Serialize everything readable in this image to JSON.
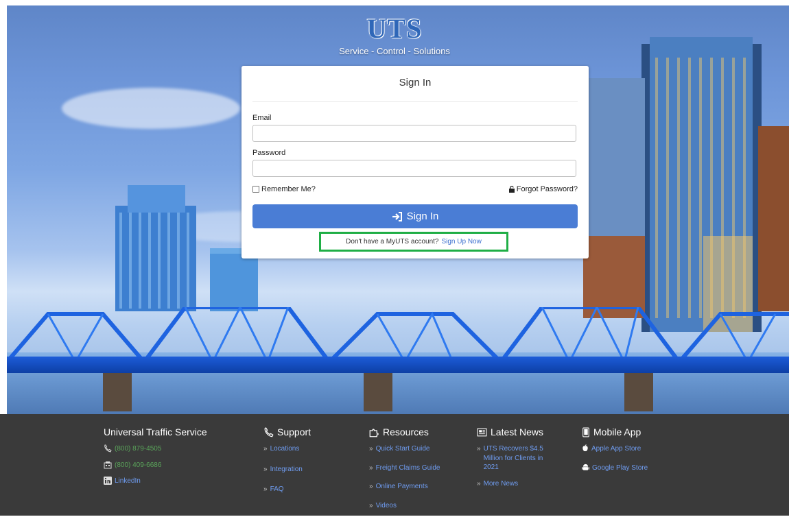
{
  "header": {
    "logo_text": "UTS",
    "tagline": "Service - Control - Solutions"
  },
  "signin_card": {
    "title": "Sign In",
    "email_label": "Email",
    "email_value": "",
    "password_label": "Password",
    "password_value": "",
    "remember_label": "Remember Me?",
    "forgot_label": "Forgot Password?",
    "signin_button_label": "Sign In",
    "signup_prompt": "Don't have a MyUTS account?",
    "signup_link": "Sign Up Now"
  },
  "footer": {
    "company": {
      "title": "Universal Traffic Service",
      "phone1": "(800) 879-4505",
      "phone2": "(800) 409-6686",
      "linkedin": "LinkedIn"
    },
    "support": {
      "title": "Support",
      "items": [
        "Locations",
        "Integration",
        "FAQ"
      ]
    },
    "resources": {
      "title": "Resources",
      "items": [
        "Quick Start Guide",
        "Freight Claims Guide",
        "Online Payments",
        "Videos"
      ]
    },
    "news": {
      "title": "Latest News",
      "items": [
        "UTS Recovers $4.5 Million for Clients in 2021",
        "More News"
      ]
    },
    "mobile": {
      "title": "Mobile App",
      "items": [
        "Apple App Store",
        "Google Play Store"
      ]
    }
  },
  "colors": {
    "accent_blue": "#4a7dd5",
    "link_blue": "#6f9cf0",
    "highlight_green": "#1fae45",
    "footer_bg": "#3a3a3a"
  }
}
